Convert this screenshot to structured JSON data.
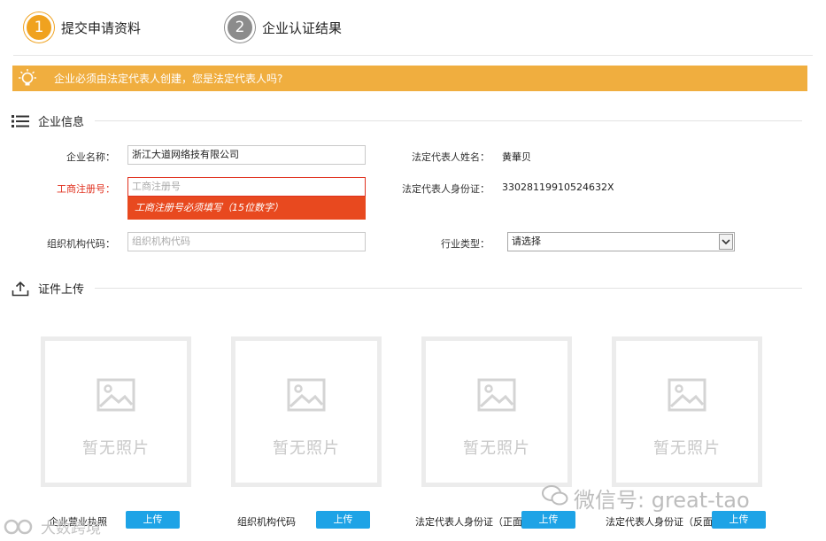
{
  "steps": [
    {
      "num": "1",
      "label": "提交申请资料"
    },
    {
      "num": "2",
      "label": "企业认证结果"
    }
  ],
  "warning": {
    "text": "企业必须由法定代表人创建，您是法定代表人吗?"
  },
  "company_section": {
    "title": "企业信息",
    "name_label": "企业名称：",
    "name_value": "浙江大道网络技有限公司",
    "reg_label": "工商注册号：",
    "reg_placeholder": "工商注册号",
    "reg_error": "工商注册号必须填写（15位数字）",
    "org_label": "组织机构代码：",
    "org_placeholder": "组织机构代码",
    "legal_name_label": "法定代表人姓名：",
    "legal_name_value": "黄華贝",
    "legal_id_label": "法定代表人身份证：",
    "legal_id_value": "33028119910524632X",
    "industry_label": "行业类型：",
    "industry_value": "请选择"
  },
  "upload_section": {
    "title": "证件上传",
    "no_photo": "暂无照片",
    "button_label": "上传",
    "items": [
      {
        "label": "企业营业执照"
      },
      {
        "label": "组织机构代码"
      },
      {
        "label": "法定代表人身份证（正面）"
      },
      {
        "label": "法定代表人身份证（反面）"
      }
    ]
  },
  "watermark": {
    "text": "微信号: great-tao"
  },
  "logo": {
    "text": "大数跨境"
  },
  "colors": {
    "accent": "#f0a21f",
    "warning_bg": "#f0ae3f",
    "error": "#e8491f",
    "button": "#1ea3e6"
  },
  "icons": [
    "lightbulb-icon",
    "list-icon",
    "upload-icon",
    "image-placeholder-icon",
    "chevron-down-icon",
    "wechat-icon"
  ]
}
